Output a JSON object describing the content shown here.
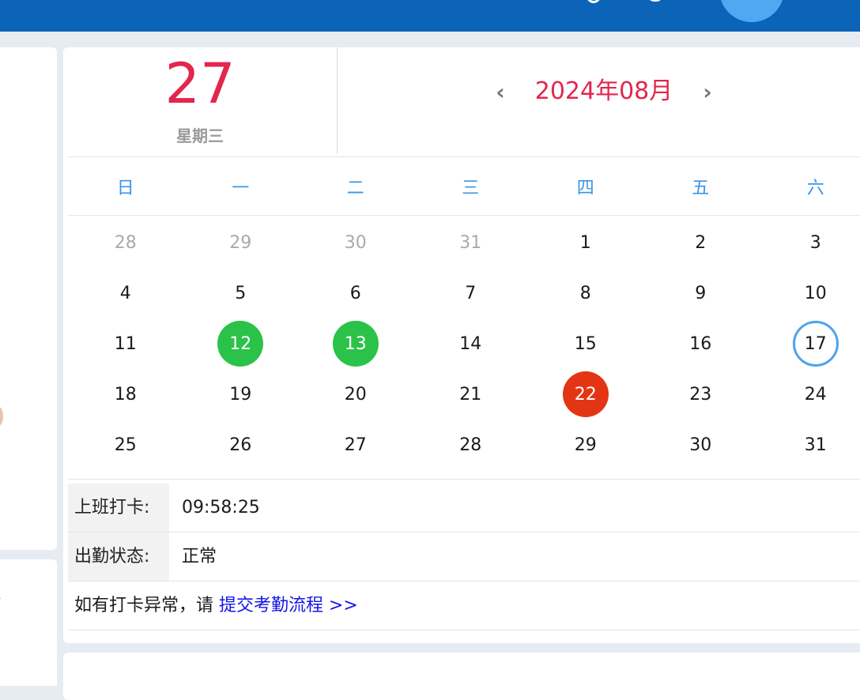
{
  "header": {
    "icons": [
      "user-icon",
      "notification-icon",
      "avatar"
    ]
  },
  "today": {
    "day": "27",
    "weekday": "星期三"
  },
  "calendar": {
    "month_title": "2024年08月",
    "prev_icon": "‹",
    "next_icon": "›",
    "weekdays": [
      "日",
      "一",
      "二",
      "三",
      "四",
      "五",
      "六"
    ],
    "weeks": [
      [
        "28",
        "29",
        "30",
        "31",
        "1",
        "2",
        "3"
      ],
      [
        "4",
        "5",
        "6",
        "7",
        "8",
        "9",
        "10"
      ],
      [
        "11",
        "12",
        "13",
        "14",
        "15",
        "16",
        "17"
      ],
      [
        "18",
        "19",
        "20",
        "21",
        "22",
        "23",
        "24"
      ],
      [
        "25",
        "26",
        "27",
        "28",
        "29",
        "30",
        "31"
      ]
    ],
    "marked_days": {
      "green": [
        "12",
        "13"
      ],
      "red": [
        "22"
      ],
      "ring": [
        "17"
      ]
    },
    "colors": {
      "green": "#2bc24a",
      "red": "#e33514",
      "ring": "#4ea3ee",
      "accent": "#e2264d",
      "weekday": "#3a95e8"
    }
  },
  "attendance": {
    "clock_in_label": "上班打卡:",
    "clock_in_value": "09:58:25",
    "status_label": "出勤状态:",
    "status_value": "正常",
    "note_text": "如有打卡异常，请 ",
    "note_link": "提交考勤流程 >>"
  }
}
